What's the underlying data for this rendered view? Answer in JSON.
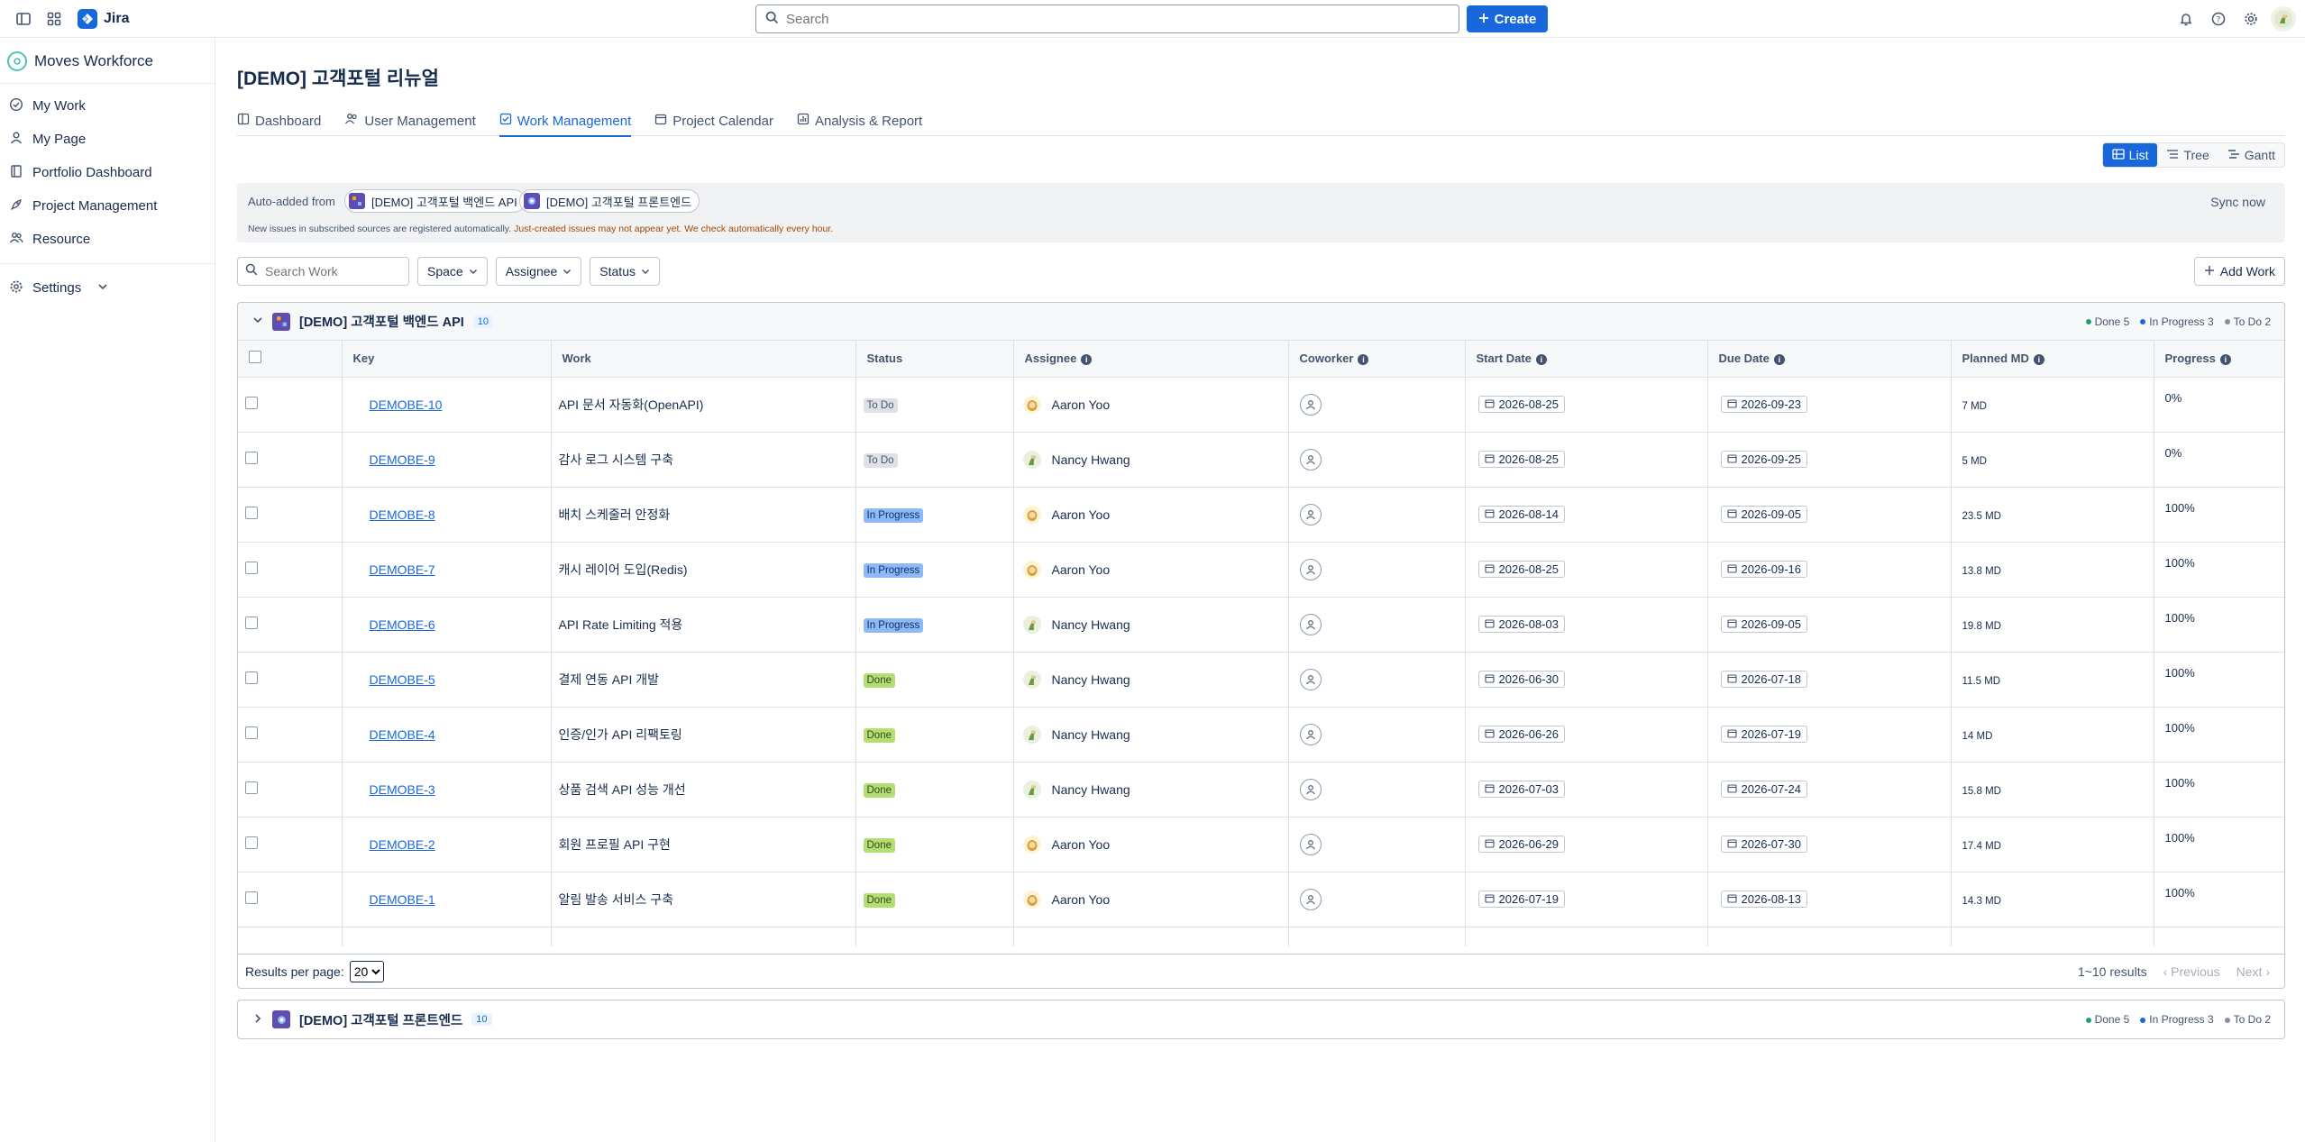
{
  "topbar": {
    "app_name": "Jira",
    "search_placeholder": "Search",
    "create_label": "Create",
    "icons": [
      "sidebar-toggle-icon",
      "app-switcher-icon",
      "bell-icon",
      "help-icon",
      "gear-icon"
    ]
  },
  "sidebar": {
    "workspace": "Moves Workforce",
    "items": [
      {
        "label": "My Work",
        "icon": "check-circle-icon"
      },
      {
        "label": "My Page",
        "icon": "user-icon"
      },
      {
        "label": "Portfolio Dashboard",
        "icon": "book-icon"
      },
      {
        "label": "Project Management",
        "icon": "rocket-icon"
      },
      {
        "label": "Resource",
        "icon": "people-icon"
      }
    ],
    "settings_label": "Settings"
  },
  "main": {
    "title": "[DEMO] 고객포털 리뉴얼",
    "tabs": [
      {
        "label": "Dashboard",
        "active": false
      },
      {
        "label": "User Management",
        "active": false
      },
      {
        "label": "Work Management",
        "active": true
      },
      {
        "label": "Project Calendar",
        "active": false
      },
      {
        "label": "Analysis & Report",
        "active": false
      }
    ],
    "views": [
      {
        "label": "List",
        "active": true
      },
      {
        "label": "Tree",
        "active": false
      },
      {
        "label": "Gantt",
        "active": false
      }
    ],
    "auto_added": {
      "label": "Auto-added from",
      "sources": [
        "[DEMO] 고객포털 백엔드 API",
        "[DEMO] 고객포털 프론트엔드"
      ],
      "sync_label": "Sync now",
      "note_normal": "New issues in subscribed sources are registered automatically.",
      "note_warn": "Just-created issues may not appear yet. We check automatically every hour."
    },
    "filters": {
      "search_placeholder": "Search Work",
      "space": "Space",
      "assignee": "Assignee",
      "status": "Status",
      "add_work": "Add Work"
    }
  },
  "group1": {
    "title": "[DEMO] 고객포털 백엔드 API",
    "count": "10",
    "legend": {
      "done": "Done 5",
      "in_progress": "In Progress 3",
      "todo": "To Do 2"
    },
    "columns": {
      "key": "Key",
      "work": "Work",
      "status": "Status",
      "assignee": "Assignee",
      "coworker": "Coworker",
      "start": "Start Date",
      "due": "Due Date",
      "planned": "Planned MD",
      "progress": "Progress"
    },
    "rows": [
      {
        "key": "DEMOBE-10",
        "work": "API 문서 자동화(OpenAPI)",
        "status": "To Do",
        "assignee": "Aaron Yoo",
        "start": "2026-08-25",
        "due": "2026-09-23",
        "planned": "7 MD",
        "progress": "0%"
      },
      {
        "key": "DEMOBE-9",
        "work": "감사 로그 시스템 구축",
        "status": "To Do",
        "assignee": "Nancy Hwang",
        "start": "2026-08-25",
        "due": "2026-09-25",
        "planned": "5 MD",
        "progress": "0%"
      },
      {
        "key": "DEMOBE-8",
        "work": "배치 스케줄러 안정화",
        "status": "In Progress",
        "assignee": "Aaron Yoo",
        "start": "2026-08-14",
        "due": "2026-09-05",
        "planned": "23.5 MD",
        "progress": "100%"
      },
      {
        "key": "DEMOBE-7",
        "work": "캐시 레이어 도입(Redis)",
        "status": "In Progress",
        "assignee": "Aaron Yoo",
        "start": "2026-08-25",
        "due": "2026-09-16",
        "planned": "13.8 MD",
        "progress": "100%"
      },
      {
        "key": "DEMOBE-6",
        "work": "API Rate Limiting 적용",
        "status": "In Progress",
        "assignee": "Nancy Hwang",
        "start": "2026-08-03",
        "due": "2026-09-05",
        "planned": "19.8 MD",
        "progress": "100%"
      },
      {
        "key": "DEMOBE-5",
        "work": "결제 연동 API 개발",
        "status": "Done",
        "assignee": "Nancy Hwang",
        "start": "2026-06-30",
        "due": "2026-07-18",
        "planned": "11.5 MD",
        "progress": "100%"
      },
      {
        "key": "DEMOBE-4",
        "work": "인증/인가 API 리팩토링",
        "status": "Done",
        "assignee": "Nancy Hwang",
        "start": "2026-06-26",
        "due": "2026-07-19",
        "planned": "14 MD",
        "progress": "100%"
      },
      {
        "key": "DEMOBE-3",
        "work": "상품 검색 API 성능 개선",
        "status": "Done",
        "assignee": "Nancy Hwang",
        "start": "2026-07-03",
        "due": "2026-07-24",
        "planned": "15.8 MD",
        "progress": "100%"
      },
      {
        "key": "DEMOBE-2",
        "work": "회원 프로필 API 구현",
        "status": "Done",
        "assignee": "Aaron Yoo",
        "start": "2026-06-29",
        "due": "2026-07-30",
        "planned": "17.4 MD",
        "progress": "100%"
      },
      {
        "key": "DEMOBE-1",
        "work": "알림 발송 서비스 구축",
        "status": "Done",
        "assignee": "Aaron Yoo",
        "start": "2026-07-19",
        "due": "2026-08-13",
        "planned": "14.3 MD",
        "progress": "100%"
      }
    ],
    "pager": {
      "per_page_label": "Results per page:",
      "per_page": "20",
      "range": "1~10 results",
      "previous": "Previous",
      "next": "Next"
    }
  },
  "group2": {
    "title": "[DEMO] 고객포털 프론트엔드",
    "count": "10",
    "legend": {
      "done": "Done 5",
      "in_progress": "In Progress 3",
      "todo": "To Do 2"
    }
  },
  "colors": {
    "accent": "#1868db",
    "done_dot": "#22a06b",
    "in_progress_dot": "#1868db",
    "todo_dot": "#8590a2"
  }
}
